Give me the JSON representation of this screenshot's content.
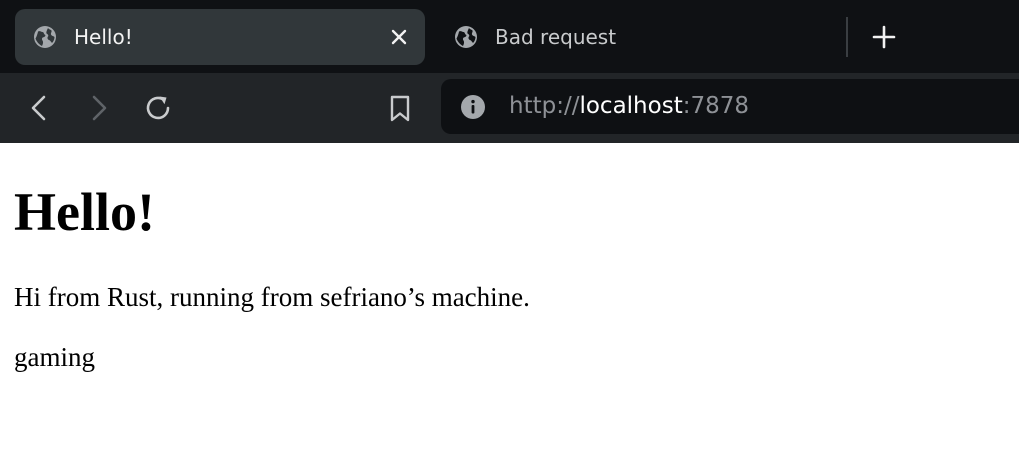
{
  "tabs": [
    {
      "title": "Hello!",
      "active": true,
      "icon": "globe-icon"
    },
    {
      "title": "Bad request",
      "active": false,
      "icon": "globe-icon"
    }
  ],
  "toolbar": {
    "icons": [
      "back-icon",
      "forward-icon",
      "reload-icon",
      "bookmark-icon",
      "info-icon",
      "new-tab-icon",
      "close-icon"
    ]
  },
  "address_bar": {
    "scheme": "http://",
    "host": "localhost",
    "port": ":7878"
  },
  "content": {
    "heading": "Hello!",
    "paragraph1": "Hi from Rust, running from sefriano’s machine.",
    "paragraph2": "gaming"
  },
  "colors": {
    "tabstrip_bg": "#0f1114",
    "active_tab_bg": "#31373a",
    "toolbar_bg": "#222528",
    "omnibox_bg": "#0e1013",
    "icon_color": "#c9cbcd",
    "disabled_icon_color": "#5f6368"
  }
}
